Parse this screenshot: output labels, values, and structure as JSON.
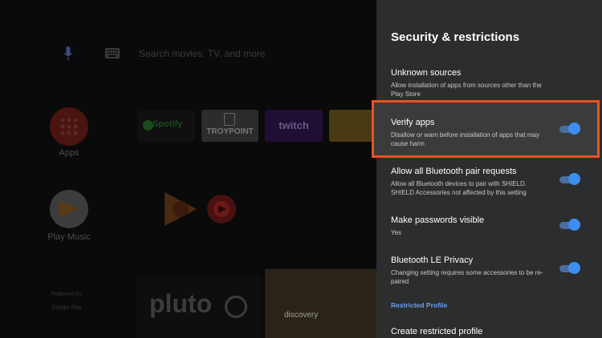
{
  "home": {
    "search_placeholder": "Search movies, TV, and more",
    "apps_label": "Apps",
    "play_music_label": "Play Music",
    "tiles": [
      "Spotify",
      "TROYPOINT",
      "twitch"
    ],
    "featured_by": "Featured by",
    "featured_sub": "Google Play",
    "pluto": "pluto",
    "discovery": "discovery"
  },
  "panel": {
    "title": "Security & restrictions",
    "settings": [
      {
        "title": "Unknown sources",
        "desc": "Allow installation of apps from sources other than the Play Store"
      },
      {
        "title": "Verify apps",
        "desc": "Disallow or warn before installation of apps that may cause harm",
        "toggle": true
      },
      {
        "title": "Allow all Bluetooth pair requests",
        "desc": "Allow all Bluetooth devices to pair with SHIELD. SHIELD Accessories not affected by this setting",
        "toggle": true
      },
      {
        "title": "Make passwords visible",
        "desc": "Yes",
        "toggle": true
      },
      {
        "title": "Bluetooth LE Privacy",
        "desc": "Changing setting requires some accessories to be re-paired",
        "toggle": true
      }
    ],
    "section_header": "Restricted Profile",
    "create_profile": "Create restricted profile"
  },
  "colors": {
    "panel_bg": "#2b2d2e",
    "highlight_border": "#e8541f",
    "toggle_on": "#3d8ef0",
    "section_header": "#6b9df0"
  }
}
